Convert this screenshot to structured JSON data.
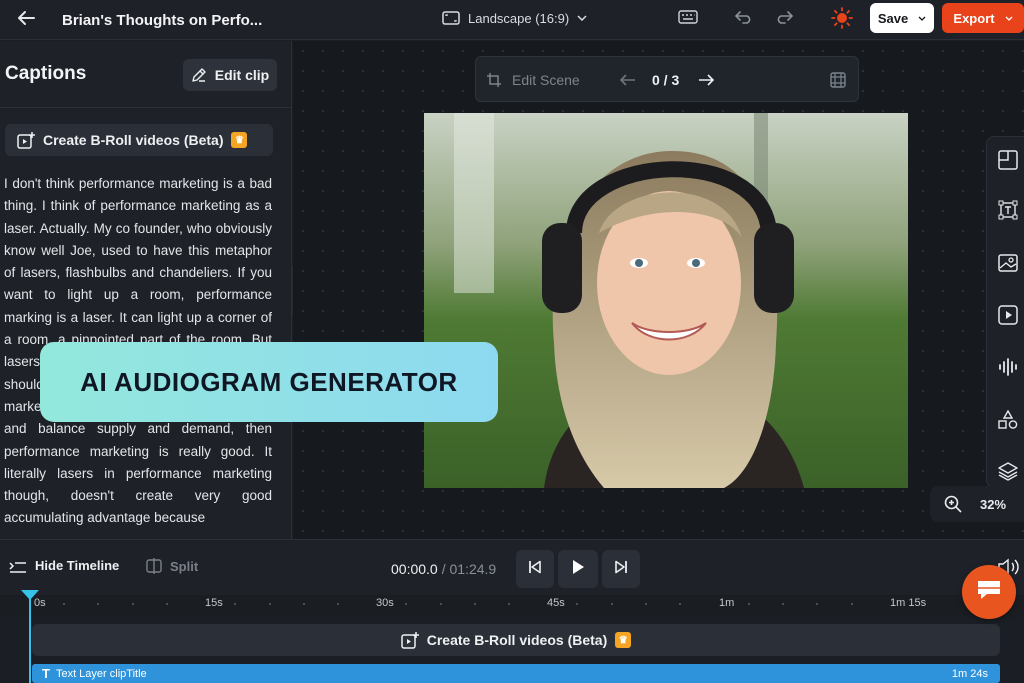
{
  "header": {
    "title": "Brian's Thoughts on Perfo...",
    "aspect_label": "Landscape (16:9)",
    "save_label": "Save",
    "export_label": "Export"
  },
  "captions": {
    "title": "Captions",
    "edit_clip_label": "Edit clip",
    "broll_label": "Create B-Roll videos (Beta)",
    "transcript": "I don't think performance marketing is a bad thing. I think of performance marketing as a laser. Actually. My co founder, who obviously know well Joe, used to have this metaphor of lasers, flashbulbs and chandeliers. If you want to light up a room, performance marking is a laser. It can light up a corner of a room, a pinpointed part of the room. But lasers can only light up a spot. And you should and learn what that part of the brand marketing is. But if you do need to laser in and balance supply and demand, then performance marketing is really good. It literally lasers in performance marketing though, doesn't create very good accumulating advantage because"
  },
  "scene": {
    "edit_scene_label": "Edit Scene",
    "counter": "0 / 3"
  },
  "banner": {
    "text": "AI AUDIOGRAM GENERATOR"
  },
  "zoom": {
    "level": "32%"
  },
  "timeline": {
    "hide_label": "Hide Timeline",
    "split_label": "Split",
    "current_time": "00:00.0",
    "total_time": "/ 01:24.9",
    "ticks": [
      "0s",
      "15s",
      "30s",
      "45s",
      "1m",
      "1m 15s"
    ],
    "broll_track_label": "Create B-Roll videos (Beta)",
    "text_layer_label": "Text Layer clipTitle",
    "text_layer_duration": "1m 24s"
  },
  "colors": {
    "accent": "#e8431a",
    "playhead": "#36c3e8",
    "text_layer": "#2f93dc",
    "premium": "#f5a524"
  }
}
